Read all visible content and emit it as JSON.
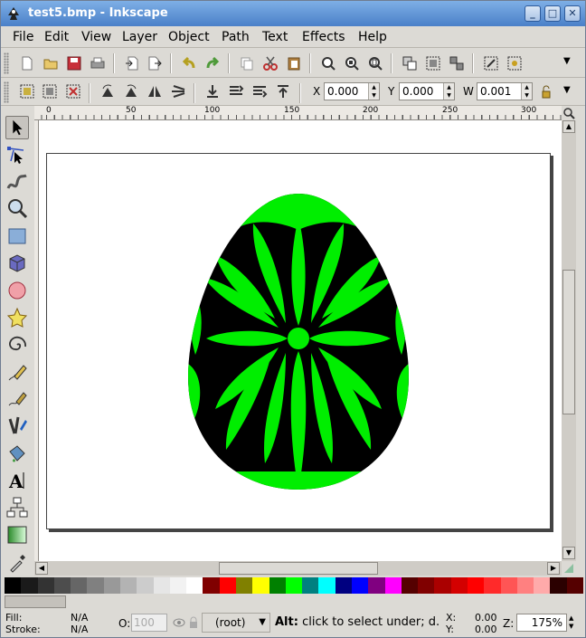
{
  "window": {
    "title": "test5.bmp - Inkscape"
  },
  "menu": [
    "File",
    "Edit",
    "View",
    "Layer",
    "Object",
    "Path",
    "Text",
    "Effects",
    "Help"
  ],
  "controls": {
    "x_label": "X",
    "x_value": "0.000",
    "y_label": "Y",
    "y_value": "0.000",
    "w_label": "W",
    "w_value": "0.001"
  },
  "ruler_ticks": [
    "0",
    "50",
    "100",
    "150",
    "200",
    "250",
    "300"
  ],
  "status": {
    "fill_label": "Fill:",
    "fill_value": "N/A",
    "stroke_label": "Stroke:",
    "stroke_value": "N/A",
    "opacity_label": "O:",
    "opacity_value": "100",
    "layer": "(root)",
    "message_bold": "Alt:",
    "message": " click to select under; d.",
    "cursor_x_label": "X:",
    "cursor_x": "0.00",
    "cursor_y_label": "Y:",
    "cursor_y": "0.00",
    "zoom_label": "Z:",
    "zoom": "175%"
  },
  "palette": [
    "#000000",
    "#1a1a1a",
    "#333333",
    "#4d4d4d",
    "#666666",
    "#808080",
    "#999999",
    "#b3b3b3",
    "#cccccc",
    "#e6e6e6",
    "#f2f2f2",
    "#ffffff",
    "#800000",
    "#ff0000",
    "#808000",
    "#ffff00",
    "#008000",
    "#00ff00",
    "#008080",
    "#00ffff",
    "#000080",
    "#0000ff",
    "#800080",
    "#ff00ff",
    "#550000",
    "#800000",
    "#aa0000",
    "#d40000",
    "#ff0000",
    "#ff2a2a",
    "#ff5555",
    "#ff8080",
    "#ffaaaa",
    "#2b0000",
    "#550000"
  ],
  "colors": {
    "egg_fill": "#00ee00",
    "egg_dark": "#000000"
  }
}
